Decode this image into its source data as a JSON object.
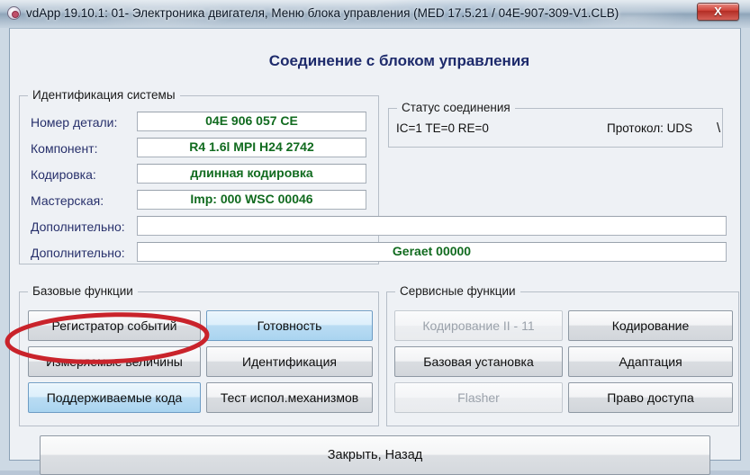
{
  "window": {
    "title": "vdApp 19.10.1: 01- Электроника двигателя,  Меню блока управления (MED 17.5.21 / 04E-907-309-V1.CLB)",
    "close_label": "X",
    "icon": "app-circle-icon"
  },
  "page": {
    "title": "Соединение с блоком управления"
  },
  "identification": {
    "group_title": "Идентификация системы",
    "rows": [
      {
        "label": "Номер детали:",
        "value": "04E 906 057 CE"
      },
      {
        "label": "Компонент:",
        "value": "R4 1.6l MPI   H24 2742"
      },
      {
        "label": "Кодировка:",
        "value": "длинная кодировка"
      },
      {
        "label": "Мастерская:",
        "value": "Imp: 000     WSC 00046"
      },
      {
        "label": "Дополнительно:",
        "value": ""
      },
      {
        "label": "Дополнительно:",
        "value": "Geraet 00000"
      }
    ]
  },
  "status": {
    "group_title": "Статус соединения",
    "flags": "IC=1  TE=0   RE=0",
    "protocol": "Протокол: UDS",
    "spinner": "\\"
  },
  "basic_functions": {
    "group_title": "Базовые функции",
    "buttons": [
      {
        "label": "Регистратор событий",
        "style": "normal",
        "enabled": true
      },
      {
        "label": "Готовность",
        "style": "blue",
        "enabled": true
      },
      {
        "label": "Измеряемые величины",
        "style": "normal",
        "enabled": true
      },
      {
        "label": "Идентификация",
        "style": "normal",
        "enabled": true
      },
      {
        "label": "Поддерживаемые кода",
        "style": "blue",
        "enabled": true
      },
      {
        "label": "Тест испол.механизмов",
        "style": "normal",
        "enabled": true
      }
    ]
  },
  "service_functions": {
    "group_title": "Сервисные функции",
    "buttons": [
      {
        "label": "Кодирование II - 11",
        "style": "disabled",
        "enabled": false
      },
      {
        "label": "Кодирование",
        "style": "normal",
        "enabled": true
      },
      {
        "label": "Базовая установка",
        "style": "normal",
        "enabled": true
      },
      {
        "label": "Адаптация",
        "style": "normal",
        "enabled": true
      },
      {
        "label": "Flasher",
        "style": "disabled",
        "enabled": false
      },
      {
        "label": "Право доступа",
        "style": "normal",
        "enabled": true
      }
    ]
  },
  "footer": {
    "close_back_label": "Закрыть, Назад"
  },
  "annotation": {
    "shape": "ellipse",
    "color": "#c9232b",
    "target": "Измеряемые величины"
  },
  "colors": {
    "title_text": "#1d2a6b",
    "label_text": "#27306b",
    "value_text": "#116b1f",
    "annotation": "#c9232b",
    "close_button": "#c8372e"
  }
}
